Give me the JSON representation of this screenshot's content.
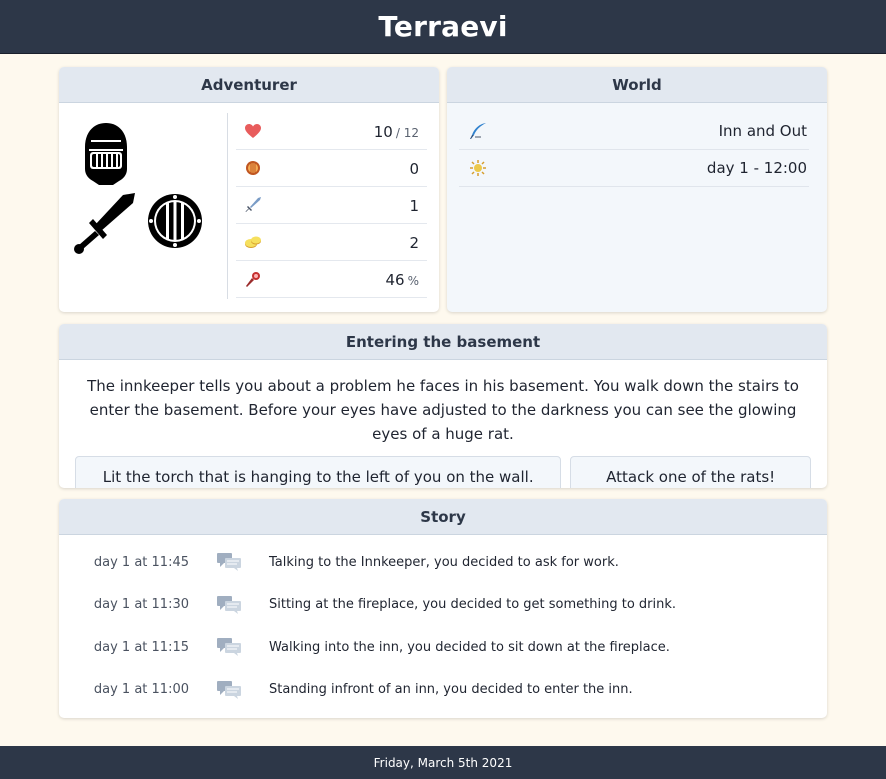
{
  "app": {
    "title": "Terraevi"
  },
  "adventurer": {
    "header": "Adventurer",
    "equipment": [
      {
        "slot": "head",
        "icon": "knight-helmet-icon"
      },
      {
        "slot": "weapon",
        "icon": "sword-icon"
      },
      {
        "slot": "shield",
        "icon": "round-shield-icon"
      }
    ],
    "stats": [
      {
        "icon": "heart-icon",
        "value": "10",
        "sub": "/ 12",
        "color": "#e53e3e"
      },
      {
        "icon": "shield-small-icon",
        "value": "0",
        "sub": "",
        "color": "#c05621"
      },
      {
        "icon": "sword-small-icon",
        "value": "1",
        "sub": "",
        "color": "#4a6fa5"
      },
      {
        "icon": "coins-icon",
        "value": "2",
        "sub": "",
        "color": "#ecc94b"
      },
      {
        "icon": "torch-icon",
        "value": "46",
        "sub": "%",
        "color": "#9b2c2c"
      }
    ]
  },
  "world": {
    "header": "World",
    "rows": [
      {
        "icon": "quill-icon",
        "value": "Inn and Out",
        "color": "#3182ce"
      },
      {
        "icon": "sun-icon",
        "value": "day 1 - 12:00",
        "color": "#d69e2e"
      }
    ]
  },
  "encounter": {
    "header": "Entering the basement",
    "text": "The innkeeper tells you about a problem he faces in his basement. You walk down the stairs to enter the basement. Before your eyes have adjusted to the darkness you can see the glowing eyes of a huge rat.",
    "choices": [
      "Lit the torch that is hanging to the left of you on the wall.",
      "Attack one of the rats!"
    ]
  },
  "story": {
    "header": "Story",
    "entries": [
      {
        "time": "day 1 at 11:45",
        "text": "Talking to the Innkeeper, you decided to ask for work."
      },
      {
        "time": "day 1 at 11:30",
        "text": "Sitting at the fireplace, you decided to get something to drink."
      },
      {
        "time": "day 1 at 11:15",
        "text": "Walking into the inn, you decided to sit down at the fireplace."
      },
      {
        "time": "day 1 at 11:00",
        "text": "Standing infront of an inn, you decided to enter the inn."
      }
    ]
  },
  "footer": {
    "date": "Friday, March 5th 2021"
  }
}
